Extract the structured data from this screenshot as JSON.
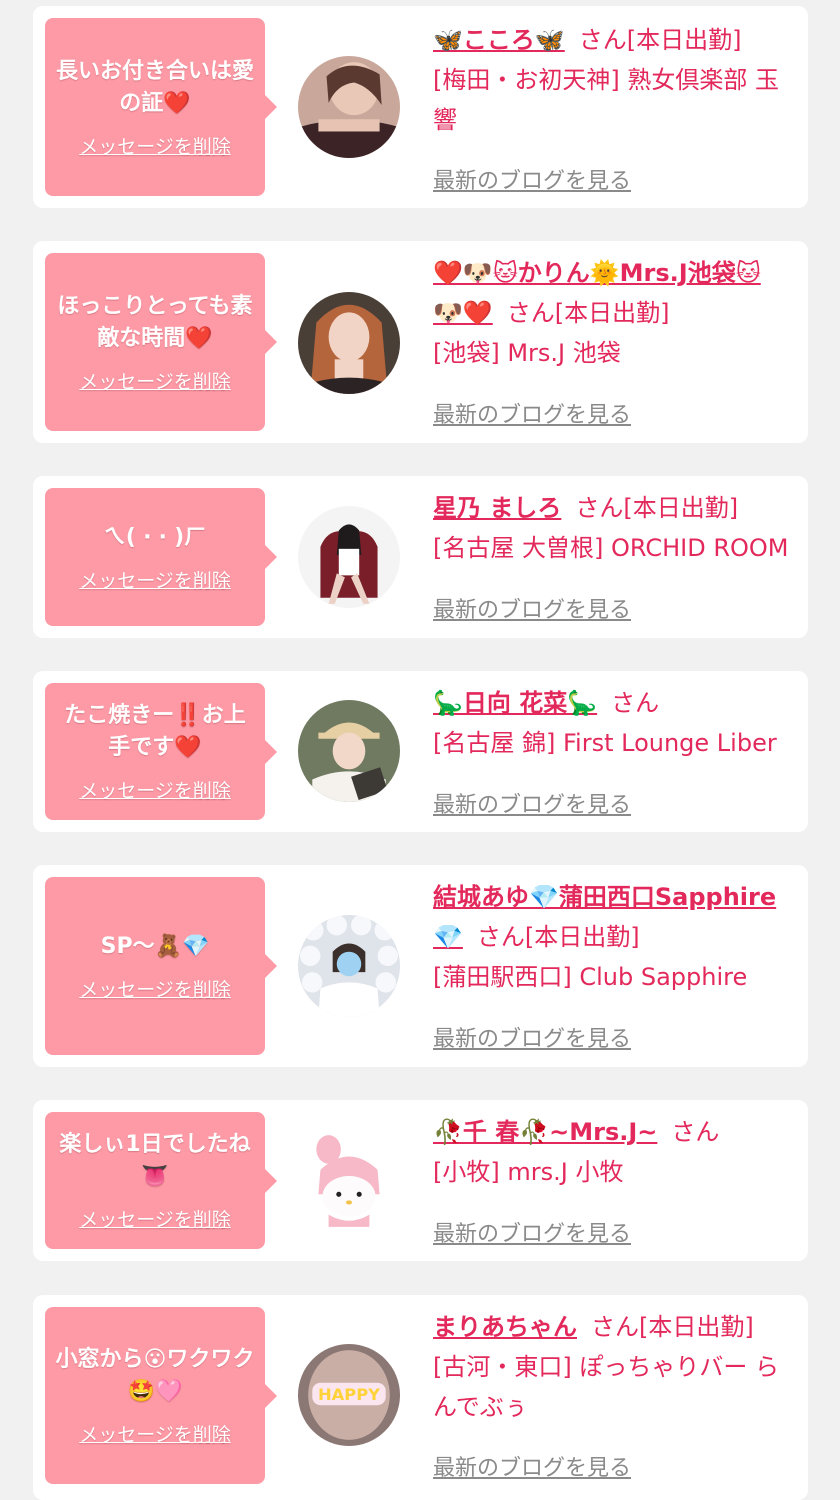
{
  "colors": {
    "accent": "#e3295b",
    "bubble": "#fd9aa6",
    "blog_link": "#8a8a8a",
    "background": "#f1f1f1"
  },
  "delete_label": "メッセージを削除",
  "blog_label": "最新のブログを見る",
  "entries": [
    {
      "message": "長いお付き合いは愛の証❤️",
      "name": "🦋こころ🦋",
      "honorific": "さん[本日出勤]",
      "shop": "[梅田・お初天神] 熟女倶楽部 玉響",
      "avatar": "woman-dark-top-avatar"
    },
    {
      "message": "ほっこりとっても素敵な時間❤️",
      "name": "❤️🐶🐱かりん🌞Mrs.J池袋🐱🐶❤️",
      "honorific": "さん[本日出勤]",
      "shop": "[池袋] Mrs.J 池袋",
      "avatar": "woman-auburn-hair-avatar"
    },
    {
      "message": "ㄟ( ‧ ‧ )ㄏ",
      "name": "星乃 ましろ",
      "honorific": "さん[本日出勤]",
      "shop": "[名古屋 大曽根] ORCHID ROOM",
      "avatar": "woman-on-chair-avatar"
    },
    {
      "message": "たこ焼きー‼️お上手です❤️",
      "name": "🦕日向 花菜🦕",
      "honorific": "さん",
      "shop": "[名古屋 錦] First Lounge Liber",
      "avatar": "woman-cap-reading-avatar"
    },
    {
      "message": "SP〜🧸💎",
      "name": "結城あゆ💎蒲田西口Sapphire💎",
      "honorific": "さん[本日出勤]",
      "shop": "[蒲田駅西口] Club Sapphire",
      "avatar": "woman-pearls-avatar"
    },
    {
      "message": "楽しぃ1日でしたね👅",
      "name": "🥀千 春🥀~Mrs.J~",
      "honorific": "さん",
      "shop": "[小牧] mrs.J 小牧",
      "avatar": "plush-character-avatar"
    },
    {
      "message": "小窓から😮ワクワク🤩🩷",
      "name": "まりあちゃん",
      "honorific": "さん[本日出勤]",
      "shop": "[古河・東口] ぽっちゃりバー らんでぶぅ",
      "avatar": "happy-sticker-avatar"
    }
  ]
}
